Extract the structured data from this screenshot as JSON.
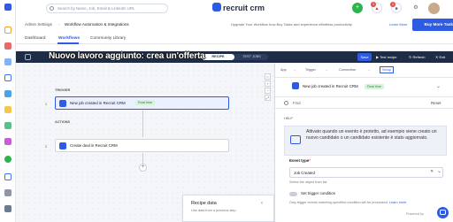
{
  "app": {
    "logo": "recruit crm"
  },
  "search": {
    "placeholder": "Search by Name, Job, Email & LinkedIn URL"
  },
  "header": {
    "plus": "+",
    "notif1": "3",
    "notif2": "3"
  },
  "breadcrumb": {
    "root": "Admin Settings",
    "sep": "›",
    "current": "Workflow Automation & Integrations"
  },
  "upgrade": {
    "text": "Upgrade Your Workflow how Buy Tasks and experience effortless productivity.",
    "learn": "Learn More",
    "buy": "Buy More Tasks"
  },
  "tabs": [
    {
      "label": "Dashboard"
    },
    {
      "label": "Workflows"
    },
    {
      "label": "Community Library"
    }
  ],
  "editor": {
    "title_banner": "Nuovo lavoro aggiunto: crea un'offerta",
    "mode_recipe": "RECIPE",
    "mode_test": "TEST JOBS",
    "save": "Save",
    "test": "Test recipe",
    "refresh": "Refresh",
    "exit": "Exit"
  },
  "canvas": {
    "trigger_label": "TRIGGER",
    "trigger_num": "1",
    "trigger_text": "New job created in Recruit CRM",
    "trigger_badge": "Real time",
    "actions_label": "ACTIONS",
    "action_num": "2",
    "action_text": "Create deal in Recruit CRM",
    "plus": "+",
    "ctrls": [
      "⌂",
      "+",
      "−",
      "⤢"
    ]
  },
  "recipe_data": {
    "title": "Recipe data",
    "subtitle": "Use data from a previous step",
    "arrow": "‹"
  },
  "panel": {
    "steps": [
      "App",
      "Trigger",
      "Connection",
      "Setup"
    ],
    "arrow": "→",
    "trigger_title": "New job created in Recruit CRM",
    "trigger_badge": "Real time",
    "search_placeholder": "Find",
    "reset": "Reset",
    "help_label": "HELP",
    "help_text": "Attivato quando un evento è protetto, ad esempio viene creato un nuovo candidato o un candidato esistente è stato aggiornato.",
    "event_type_label": "Event type",
    "event_type_value": "Job Created",
    "event_type_hint": "Select the object from list",
    "trigger_cond_label": "Set trigger condition",
    "trigger_cond_hint": "Only trigger events matching specified condition will be processed.",
    "learn_more": "Learn more",
    "powered": "Powered by"
  },
  "colors": {
    "accent": "#2d5be3",
    "editor_bar": "#1e2c45",
    "green": "#2eb44d",
    "red": "#e44b4b"
  }
}
